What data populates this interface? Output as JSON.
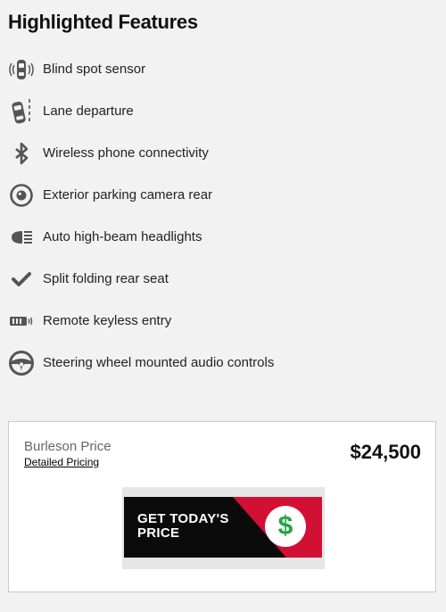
{
  "section": {
    "title": "Highlighted Features"
  },
  "features": [
    {
      "label": "Blind spot sensor",
      "icon": "blind-spot-sensor-icon"
    },
    {
      "label": "Lane departure",
      "icon": "lane-departure-icon"
    },
    {
      "label": "Wireless phone connectivity",
      "icon": "bluetooth-icon"
    },
    {
      "label": "Exterior parking camera rear",
      "icon": "camera-icon"
    },
    {
      "label": "Auto high-beam headlights",
      "icon": "headlight-icon"
    },
    {
      "label": "Split folding rear seat",
      "icon": "checkmark-icon"
    },
    {
      "label": "Remote keyless entry",
      "icon": "key-fob-icon"
    },
    {
      "label": "Steering wheel mounted audio controls",
      "icon": "steering-wheel-icon"
    }
  ],
  "price": {
    "label": "Burleson Price",
    "link": "Detailed Pricing",
    "value": "$24,500"
  },
  "cta": {
    "line1": "GET TODAY'S",
    "line2": "PRICE",
    "symbol": "$"
  },
  "colors": {
    "background": "#f2f2f2",
    "cta_red": "#d21033",
    "cta_black": "#0b0b0b",
    "dollar_green": "#23a443",
    "icon_gray": "#555555"
  }
}
